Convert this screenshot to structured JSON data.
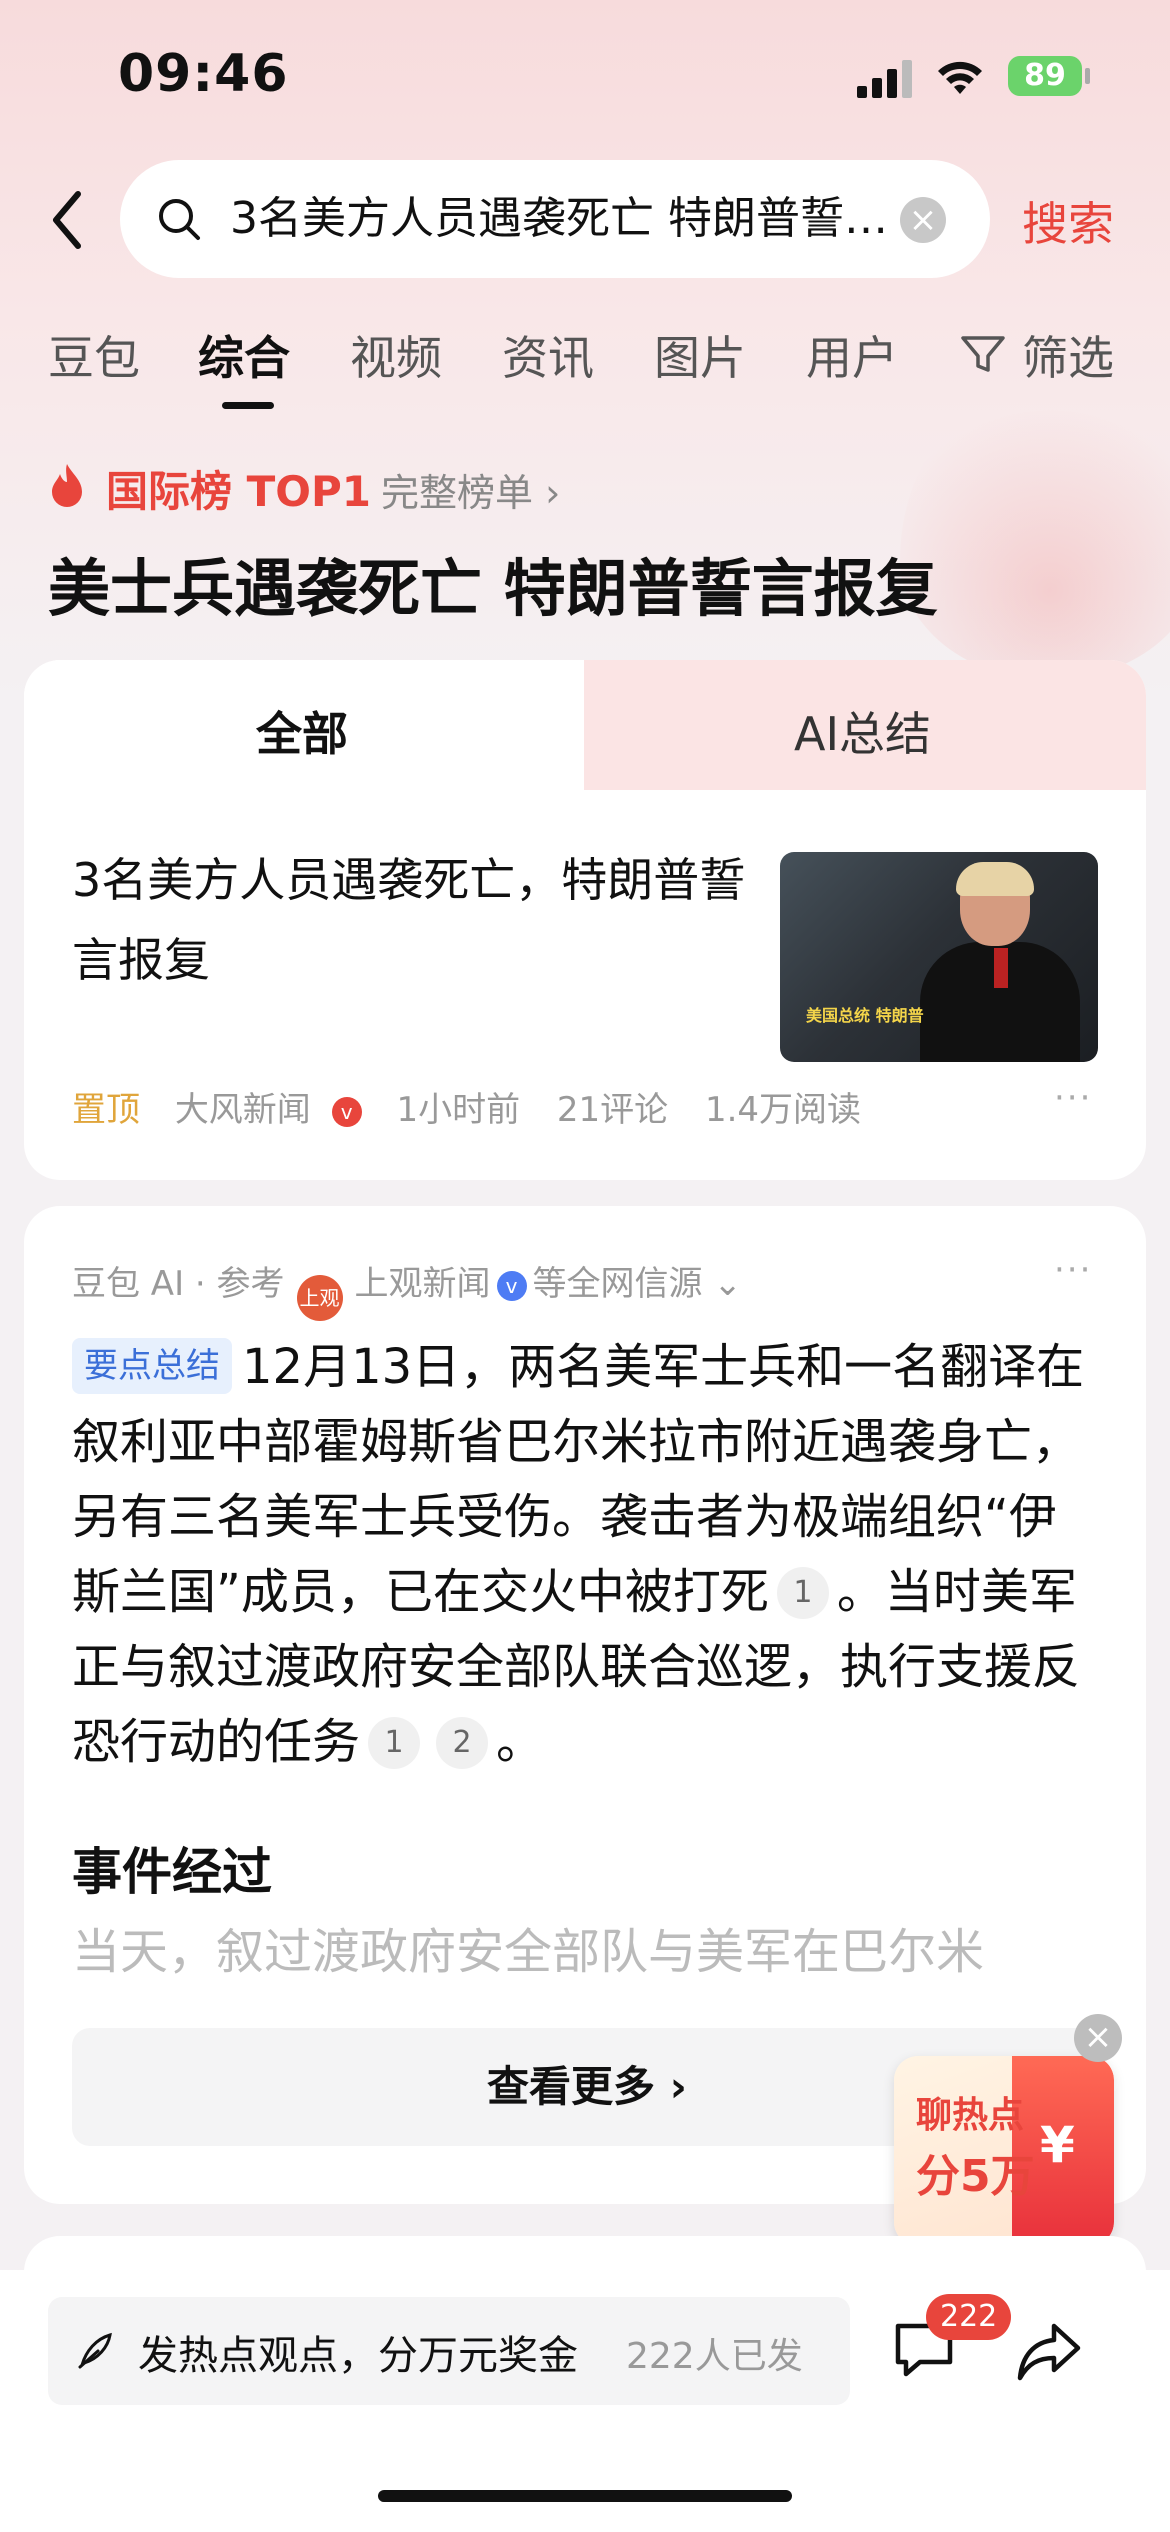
{
  "status": {
    "time": "09:46",
    "battery": "89"
  },
  "search": {
    "query": "3名美方人员遇袭死亡 特朗普誓言报复",
    "button": "搜索"
  },
  "tabs": [
    "豆包",
    "综合",
    "视频",
    "资讯",
    "图片",
    "用户",
    "筛选"
  ],
  "active_tab": "综合",
  "hot": {
    "label": "国际榜 TOP1",
    "full_list": "完整榜单 ›",
    "headline": "美士兵遇袭死亡 特朗普誓言报复"
  },
  "segment": {
    "all": "全部",
    "ai": "AI总结"
  },
  "news": {
    "title": "3名美方人员遇袭死亡，特朗普誓言报复",
    "thumb_caption": "美国总统 特朗普",
    "pin": "置顶",
    "source": "大风新闻",
    "time": "1小时前",
    "comments": "21评论",
    "reads": "1.4万阅读"
  },
  "ai_card": {
    "brand": "豆包 AI · 参考",
    "ref_logo": "上观",
    "ref_source": "上观新闻",
    "ref_more": "等全网信源 ⌄",
    "tag": "要点总结",
    "summary_part1": "12月13日，两名美军士兵和一名翻译在叙利亚中部霍姆斯省巴尔米拉市附近遇袭身亡，另有三名美军士兵受伤。袭击者为极端组织“伊斯兰国”成员，已在交火中被打死",
    "cite1": "1",
    "summary_part2": "。当时美军正与叙过渡政府安全部队联合巡逻，执行支援反恐行动的任务",
    "cite2": "1",
    "cite3": "2",
    "summary_end": "。",
    "section_title": "事件经过",
    "section_body": "当天，叙过渡政府安全部队与美军在巴尔米",
    "see_more": "查看更多 ›"
  },
  "promo": {
    "line1": "聊热点",
    "line2": "分5万",
    "yen": "¥"
  },
  "bottom": {
    "compose": "发热点观点，分万元奖金",
    "compose_count": "222人已发",
    "comment_badge": "222"
  }
}
